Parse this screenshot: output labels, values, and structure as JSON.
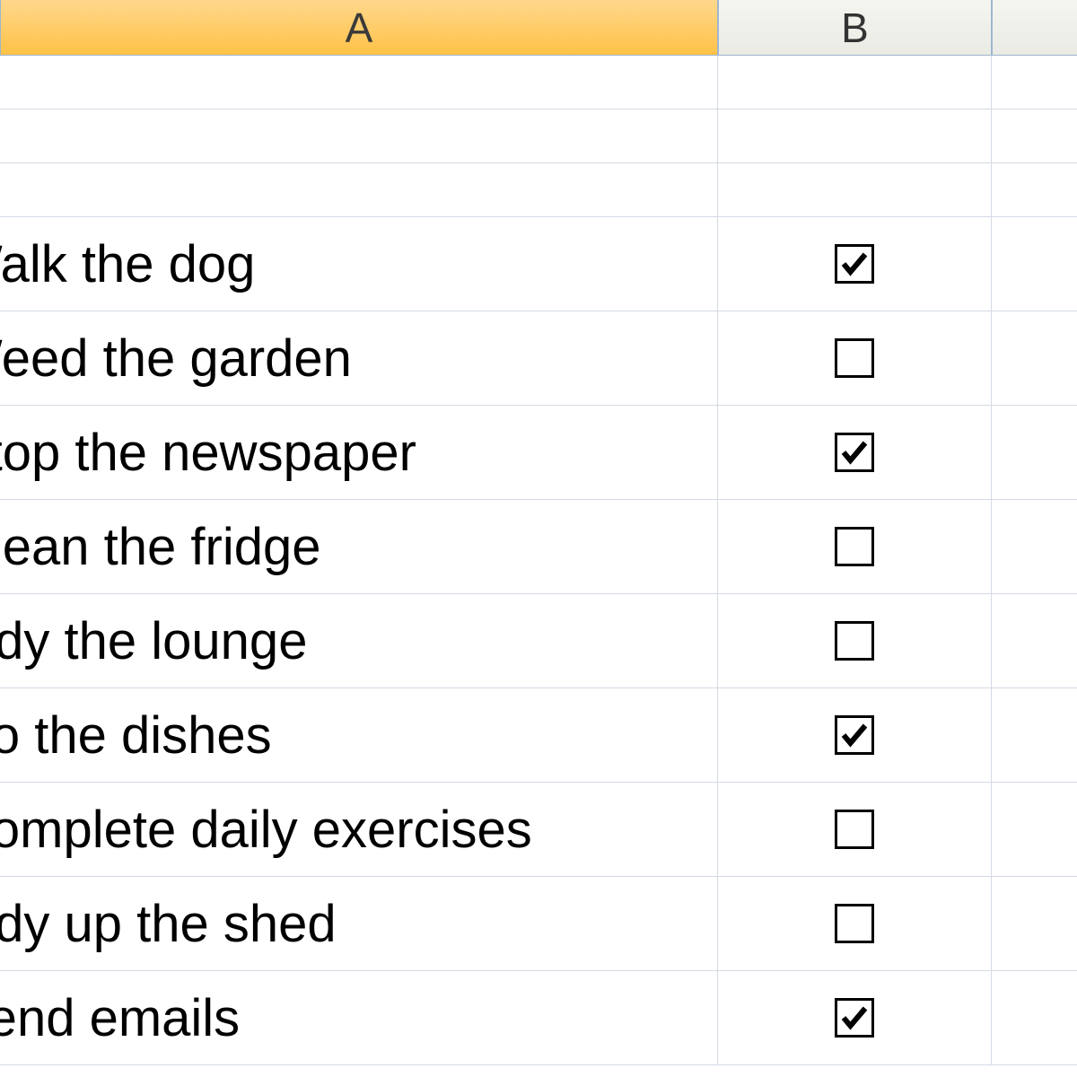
{
  "columns": {
    "a": "A",
    "b": "B"
  },
  "rows": [
    {
      "task": "Walk the dog",
      "checked": true
    },
    {
      "task": "Weed the garden",
      "checked": false
    },
    {
      "task": "Stop the newspaper",
      "checked": true
    },
    {
      "task": "Clean the fridge",
      "checked": false
    },
    {
      "task": "Tidy the lounge",
      "checked": false
    },
    {
      "task": "Do the dishes",
      "checked": true
    },
    {
      "task": "Complete daily exercises",
      "checked": false
    },
    {
      "task": "Tidy up the shed",
      "checked": false
    },
    {
      "task": "Send emails",
      "checked": true
    }
  ]
}
